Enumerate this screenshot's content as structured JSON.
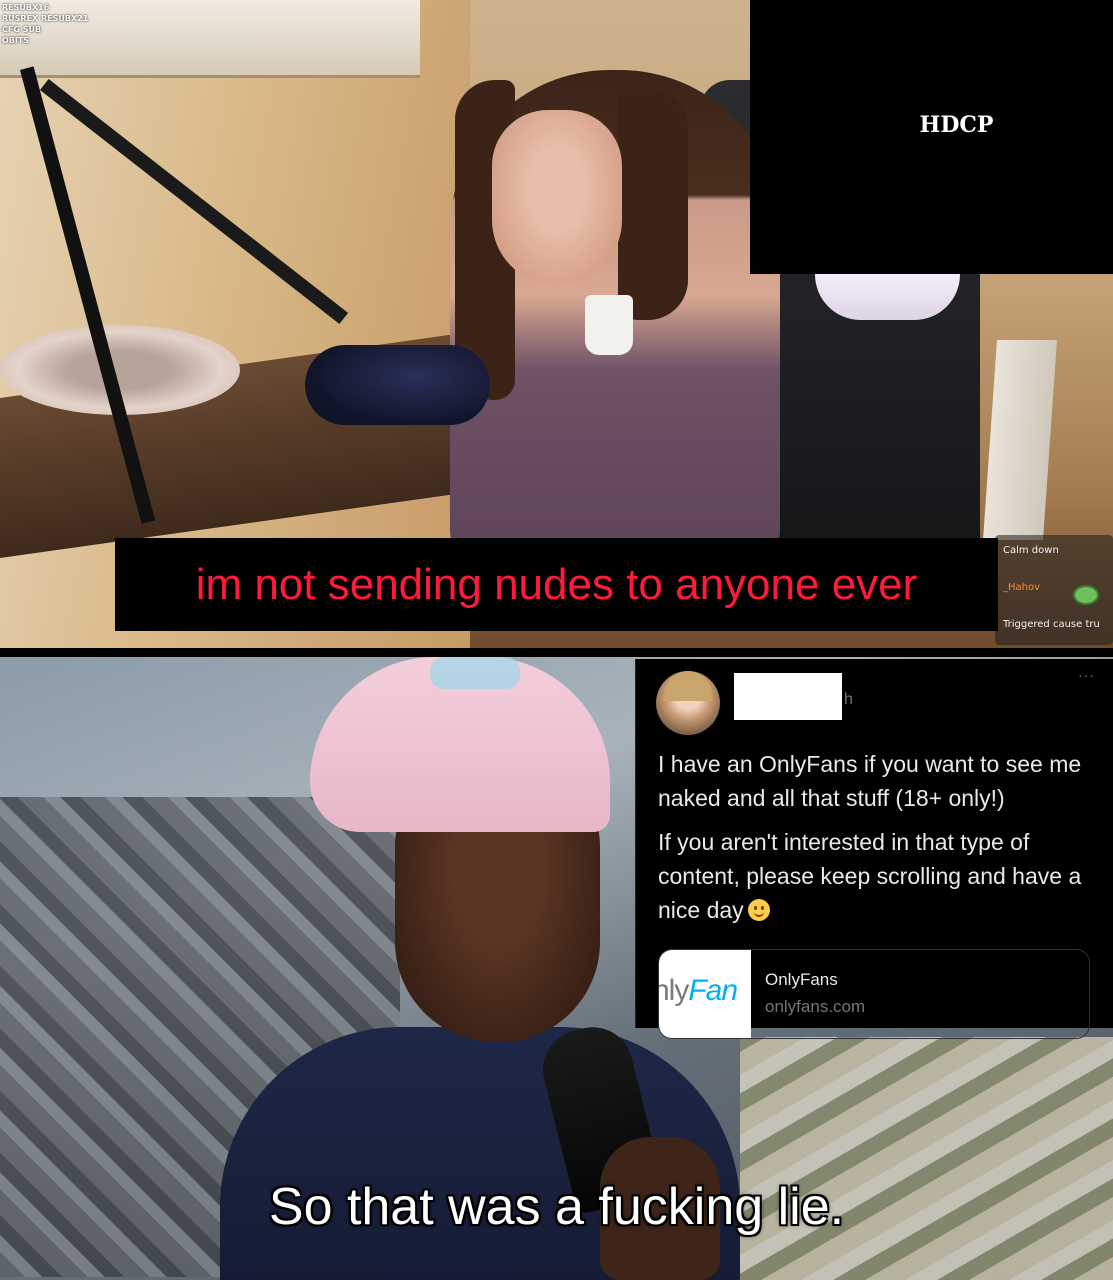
{
  "top_panel": {
    "overlay_text": [
      "RESUBX16",
      "RUSREX RESUBX21",
      "CFG SUB",
      "OBITS"
    ],
    "hdcp_label": "HDCP",
    "subtitle": "im not sending nudes to anyone ever",
    "chat": {
      "line1": "Calm down",
      "line2_name": "_Hahov",
      "line3": "Triggered cause tru"
    }
  },
  "tweet": {
    "handle_tail": "h",
    "more": "···",
    "paragraph1": "I have an OnlyFans if you want to see me naked and all that stuff (18+ only!)",
    "paragraph2": "If you aren't interested in that type of content, please keep scrolling and have a nice day",
    "emoji": "slightly-smiling-face",
    "link": {
      "thumb_prefix": "nly",
      "thumb_brand": "Fan",
      "title": "OnlyFans",
      "domain": "onlyfans.com"
    }
  },
  "bottom_panel": {
    "subtitle": "So that was a fucking lie."
  },
  "colors": {
    "subtitle_red": "#ff1a3c",
    "onlyfans_blue": "#00aff0",
    "tweet_bg": "#000000"
  }
}
